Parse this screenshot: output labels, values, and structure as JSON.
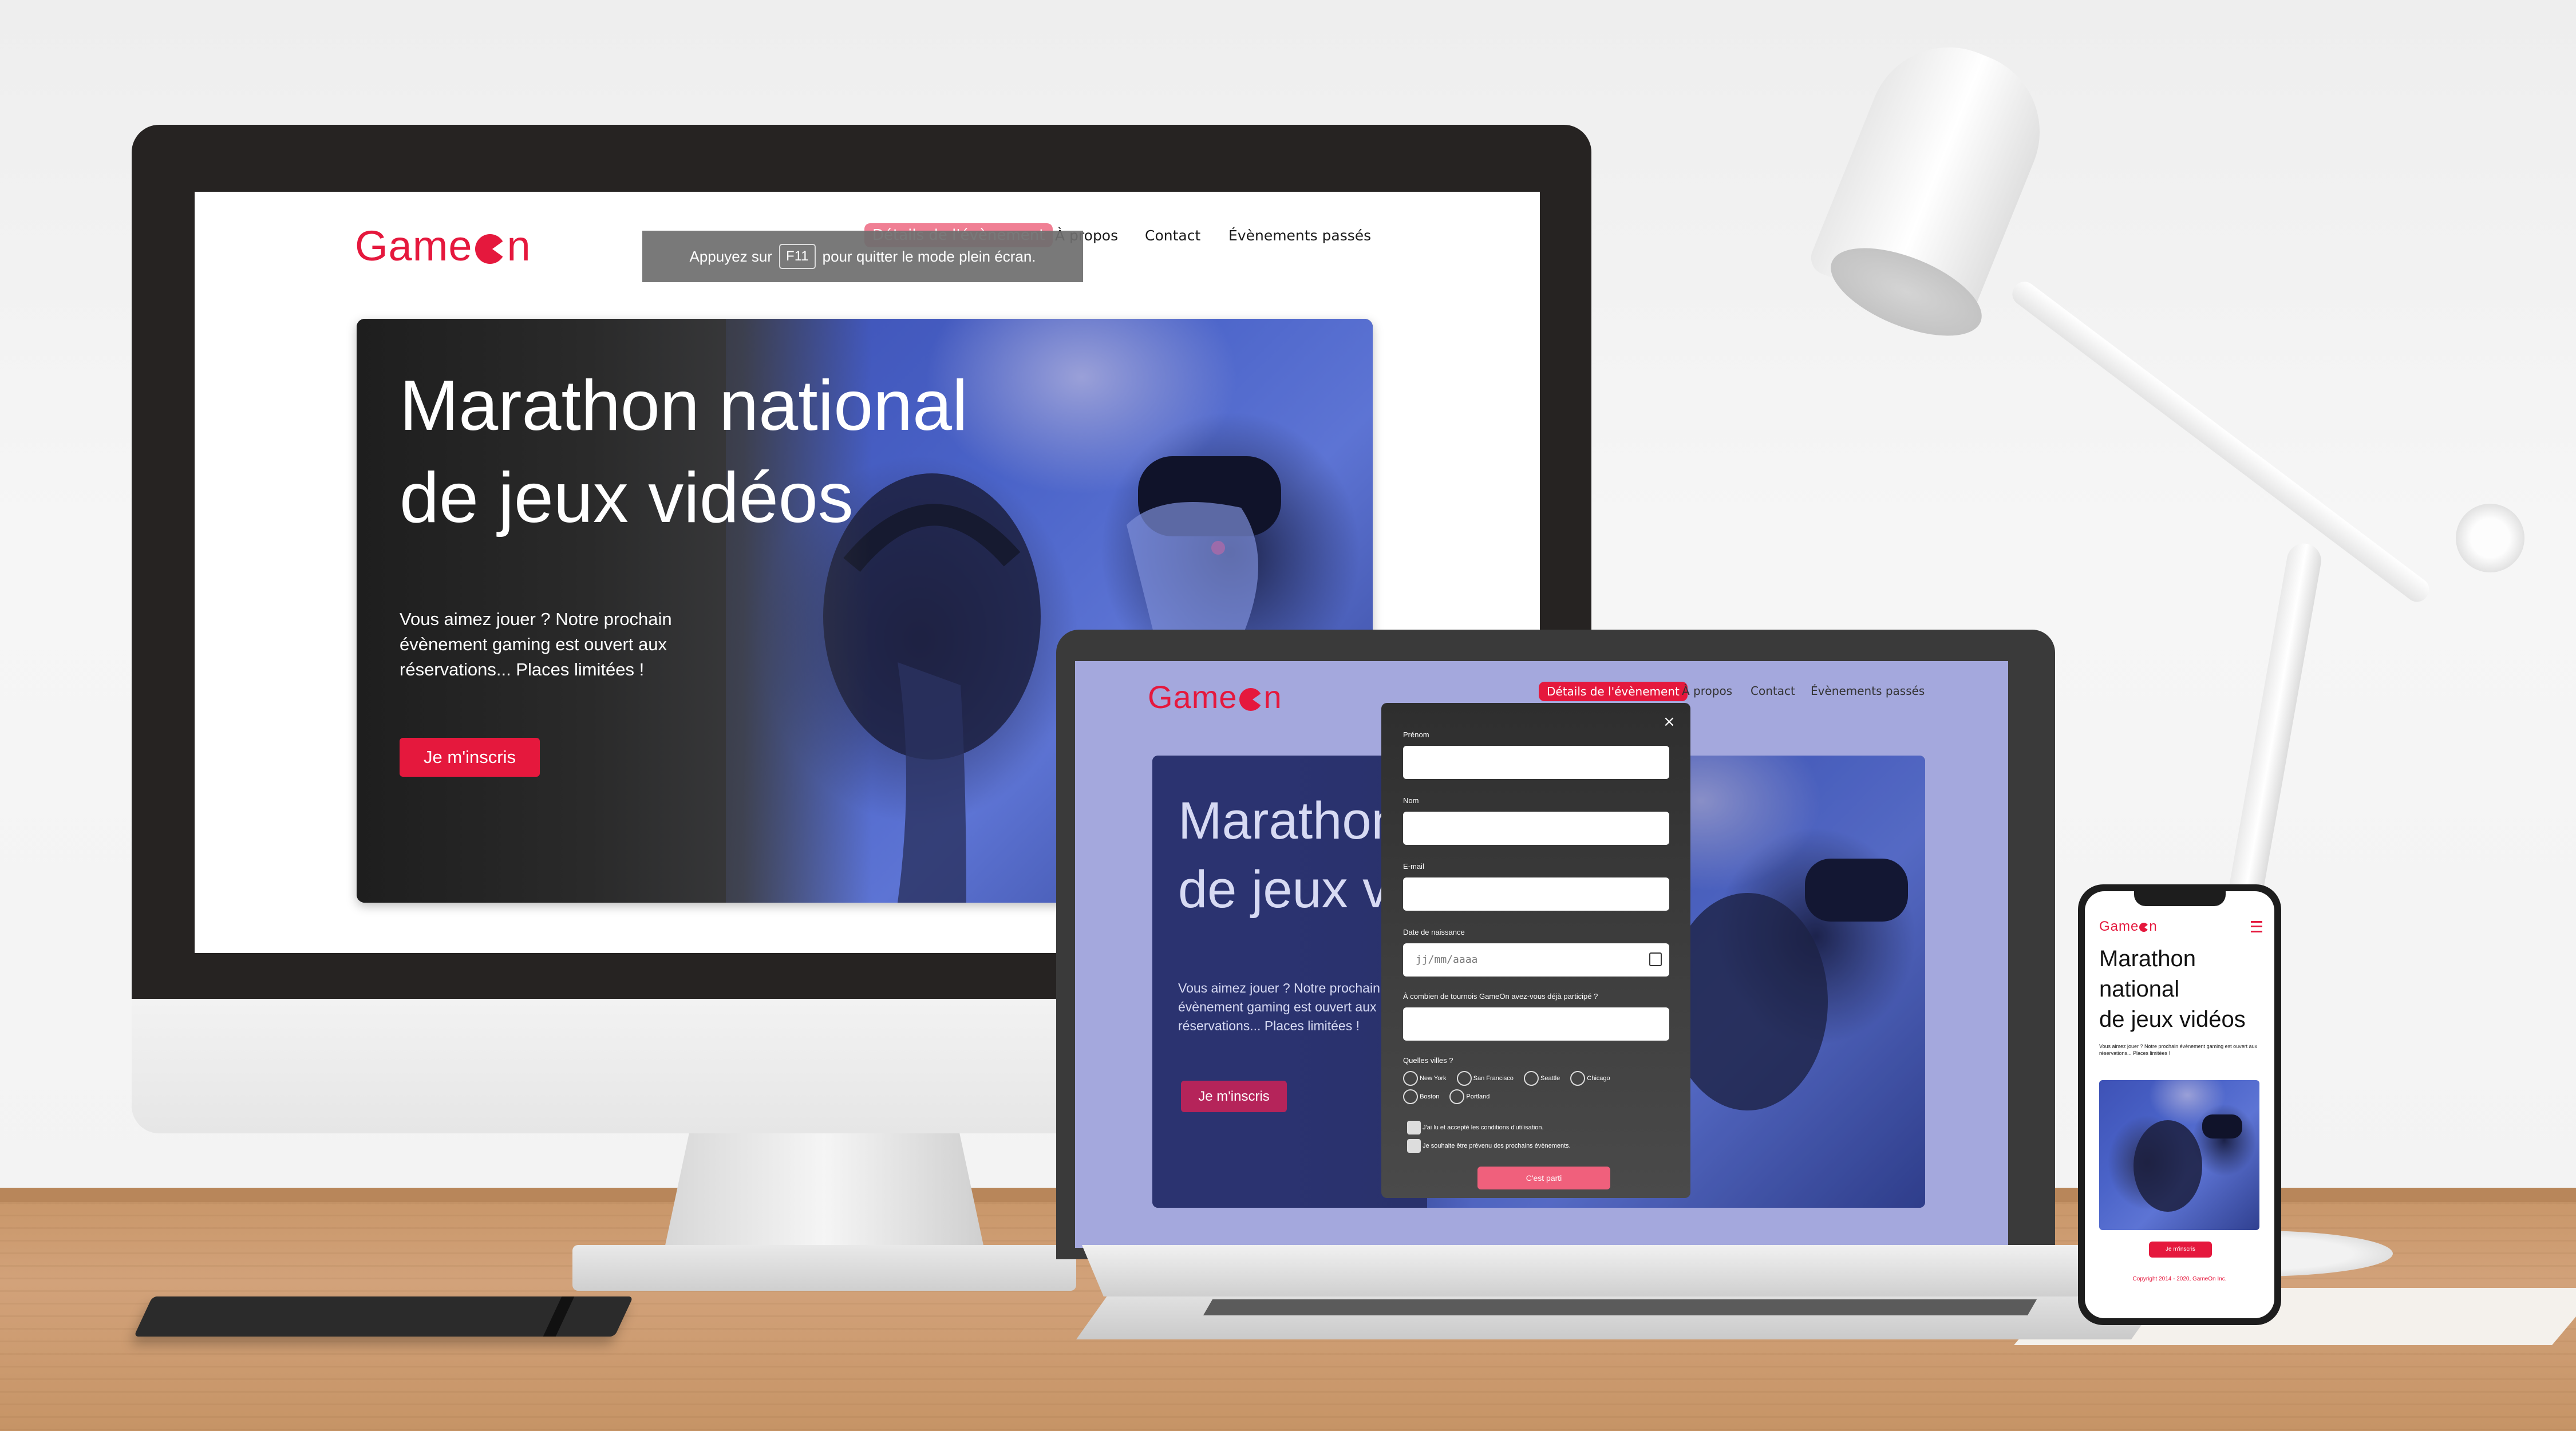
{
  "brand": {
    "logo_left": "Game",
    "logo_right": "n",
    "accent": "#e5183d"
  },
  "desktop": {
    "nav": {
      "items": [
        "Détails de l'évènement",
        "À propos",
        "Contact",
        "Évènements passés"
      ]
    },
    "fullscreen_notice": {
      "before": "Appuyez sur",
      "key": "F11",
      "after": "pour quitter le mode plein écran."
    },
    "hero": {
      "title_line1": "Marathon national",
      "title_line2": "de jeux vidéos",
      "text_line1": "Vous aimez jouer ? Notre prochain",
      "text_line2": "évènement gaming est ouvert aux",
      "text_line3": "réservations... Places limitées !",
      "cta": "Je m'inscris"
    }
  },
  "laptop": {
    "nav": {
      "items": [
        "Détails de l'évènement",
        "À propos",
        "Contact",
        "Évènements passés"
      ]
    },
    "hero": {
      "title_line1": "Marathon national",
      "title_line2": "de jeux vidéos",
      "text_line1": "Vous aimez jouer ? Notre prochain",
      "text_line2": "évènement gaming est ouvert aux",
      "text_line3": "réservations... Places limitées !",
      "cta": "Je m'inscris"
    },
    "form": {
      "close": "×",
      "first_name_label": "Prénom",
      "last_name_label": "Nom",
      "email_label": "E-mail",
      "birthdate_label": "Date de naissance",
      "birthdate_placeholder": "jj/mm/aaaa",
      "tournaments_label": "À combien de tournois GameOn avez-vous déjà participé ?",
      "cities_label": "Quelles villes ?",
      "cities": [
        "New York",
        "San Francisco",
        "Seattle",
        "Chicago",
        "Boston",
        "Portland"
      ],
      "terms_label": "J'ai lu et accepté les conditions d'utilisation.",
      "newsletter_label": "Je souhaite être prévenu des prochains évènements.",
      "submit": "C'est parti"
    }
  },
  "phone": {
    "hero": {
      "title_line1": "Marathon",
      "title_line2": "national",
      "title_line3": "de jeux vidéos",
      "text": "Vous aimez jouer ? Notre prochain évènement gaming est ouvert aux réservations... Places limitées !",
      "cta": "Je m'inscris"
    },
    "footer": "Copyright 2014 - 2020, GameOn Inc."
  }
}
